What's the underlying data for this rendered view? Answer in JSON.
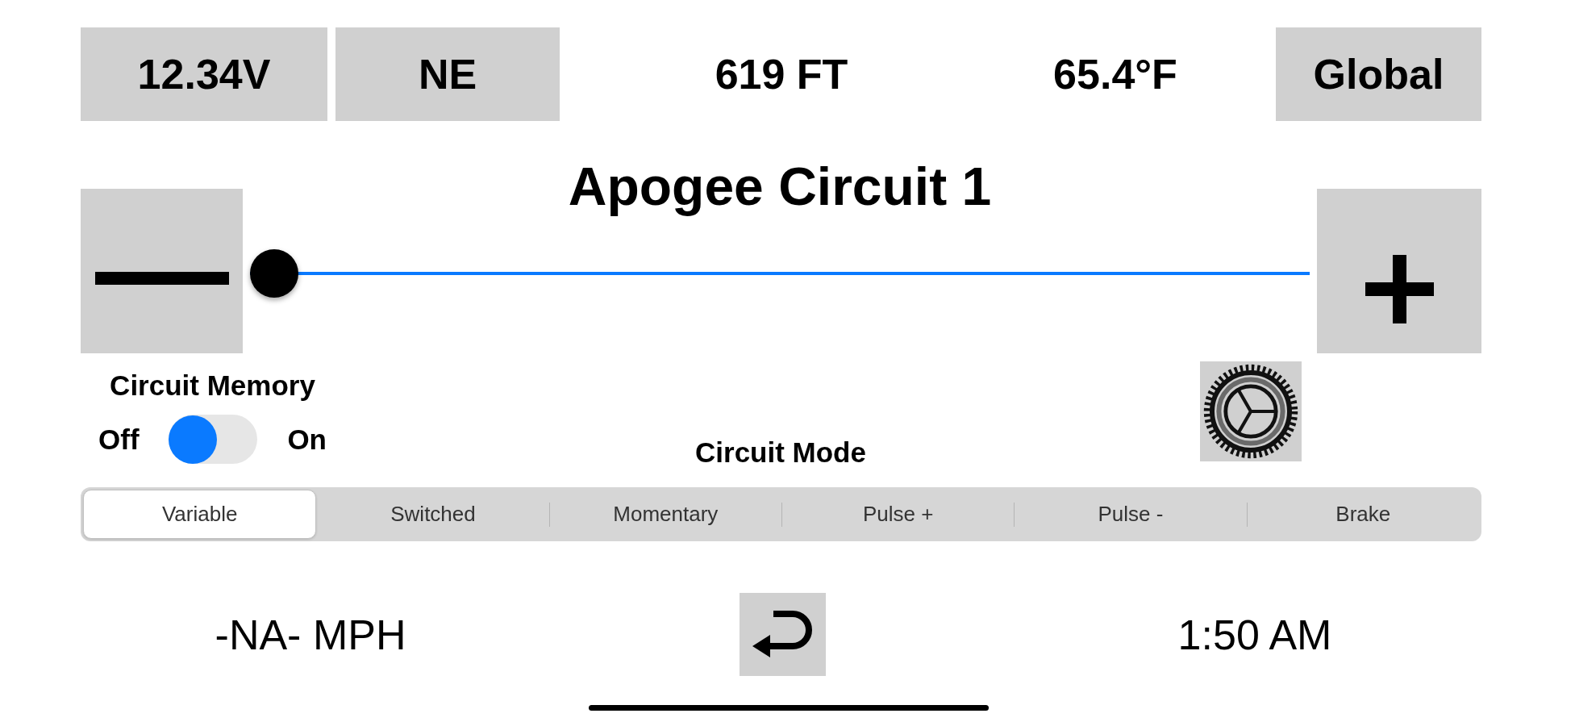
{
  "top_bar": [
    {
      "kind": "tile",
      "text": "12.34V"
    },
    {
      "kind": "tile",
      "text": "NE"
    },
    {
      "kind": "reading",
      "text": "619 FT"
    },
    {
      "kind": "reading",
      "text": "65.4°F"
    },
    {
      "kind": "button",
      "text": "Global"
    }
  ],
  "title": "Apogee Circuit 1",
  "slider": {
    "level": 0
  },
  "circuit_memory": {
    "label": "Circuit Memory",
    "off_label": "Off",
    "on_label": "On",
    "on": false
  },
  "circuit_mode": {
    "label": "Circuit Mode",
    "segments": [
      {
        "label": "Variable",
        "selected": true
      },
      {
        "label": "Switched",
        "selected": false
      },
      {
        "label": "Momentary",
        "selected": false
      },
      {
        "label": "Pulse +",
        "selected": false
      },
      {
        "label": "Pulse -",
        "selected": false
      },
      {
        "label": "Brake",
        "selected": false
      }
    ]
  },
  "bottom_bar": {
    "speed": "-NA- MPH",
    "time": "1:50 AM"
  }
}
